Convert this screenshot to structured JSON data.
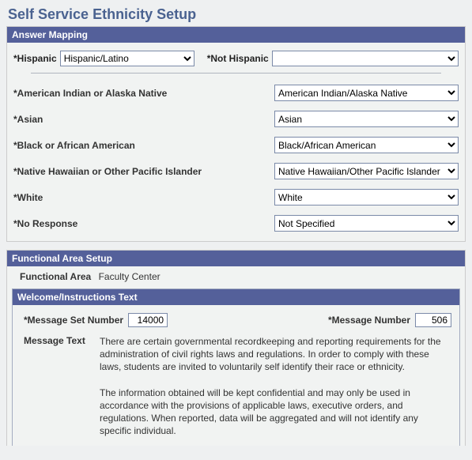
{
  "page": {
    "title": "Self Service Ethnicity Setup"
  },
  "answer_mapping": {
    "header": "Answer Mapping",
    "hispanic": {
      "label": "*Hispanic",
      "value": "Hispanic/Latino"
    },
    "not_hispanic": {
      "label": "*Not Hispanic",
      "value": ""
    },
    "rows": [
      {
        "label": "*American Indian or Alaska Native",
        "value": "American Indian/Alaska Native"
      },
      {
        "label": "*Asian",
        "value": "Asian"
      },
      {
        "label": "*Black or African American",
        "value": "Black/African American"
      },
      {
        "label": "*Native Hawaiian or Other Pacific Islander",
        "value": "Native Hawaiian/Other Pacific Islander"
      },
      {
        "label": "*White",
        "value": "White"
      },
      {
        "label": "*No Response",
        "value": "Not Specified"
      }
    ]
  },
  "functional_area": {
    "header": "Functional Area Setup",
    "label": "Functional Area",
    "value": "Faculty Center"
  },
  "welcome": {
    "header": "Welcome/Instructions Text",
    "set_label": "*Message Set Number",
    "set_value": "14000",
    "num_label": "*Message Number",
    "num_value": "506",
    "text_label": "Message Text",
    "text_body": "There are certain governmental recordkeeping and reporting requirements for the administration of civil rights laws and regulations. In order to comply with these laws, students are invited to voluntarily self identify their race or ethnicity.\n\nThe information obtained will be kept confidential and may only be used in accordance with the provisions of applicable laws, executive orders, and regulations. When reported, data will be aggregated and will not identify any specific individual."
  }
}
